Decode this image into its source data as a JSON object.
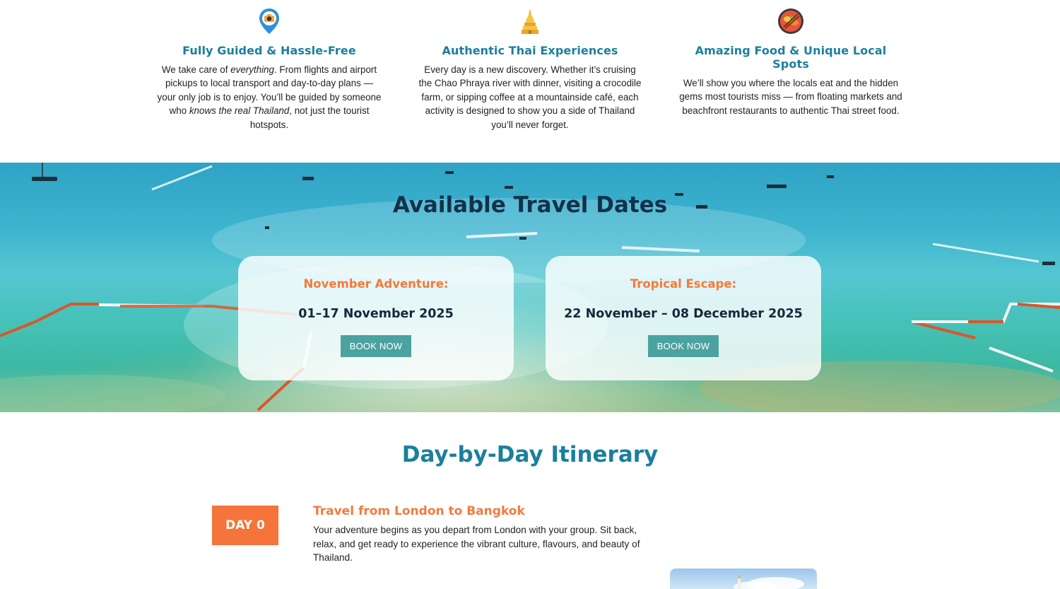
{
  "features": [
    {
      "icon": "map-pin-camera-icon",
      "title": "Fully Guided & Hassle-Free",
      "text_parts": [
        "We take care of ",
        "everything",
        ". From flights and airport pickups to local transport and day-to-day plans — your only job is to enjoy. You’ll be guided by someone who ",
        "knows the real Thailand",
        ", not just the tourist hotspots."
      ]
    },
    {
      "icon": "thai-temple-icon",
      "title": "Authentic Thai Experiences",
      "text": "Every day is a new discovery. Whether it’s cruising the Chao Phraya river with dinner, visiting a crocodile farm, or sipping coffee at a mountainside café, each activity is designed to show you a side of Thailand you’ll never forget."
    },
    {
      "icon": "street-food-bowl-icon",
      "title": "Amazing Food & Unique Local Spots",
      "text": "We’ll show you where the locals eat and the hidden gems most tourists miss — from floating markets and beachfront restaurants to authentic Thai street food."
    }
  ],
  "travel_dates": {
    "heading": "Available Travel Dates",
    "cards": [
      {
        "title": "November Adventure:",
        "dates": "01–17 November 2025",
        "button": "BOOK NOW"
      },
      {
        "title": "Tropical Escape:",
        "dates": "22 November – 08 December 2025",
        "button": "BOOK NOW"
      }
    ]
  },
  "itinerary": {
    "heading": "Day-by-Day Itinerary",
    "days": [
      {
        "badge": "DAY 0",
        "title": "Travel from London to Bangkok",
        "text": "Your adventure begins as you depart from London with your group. Sit back, relax, and get ready to experience the vibrant culture, flavours, and beauty of Thailand."
      }
    ]
  },
  "colors": {
    "heading_teal": "#1b7f9e",
    "accent_orange": "#f47a3c",
    "button_teal": "#4aa3a0",
    "dark_navy": "#12324a"
  }
}
